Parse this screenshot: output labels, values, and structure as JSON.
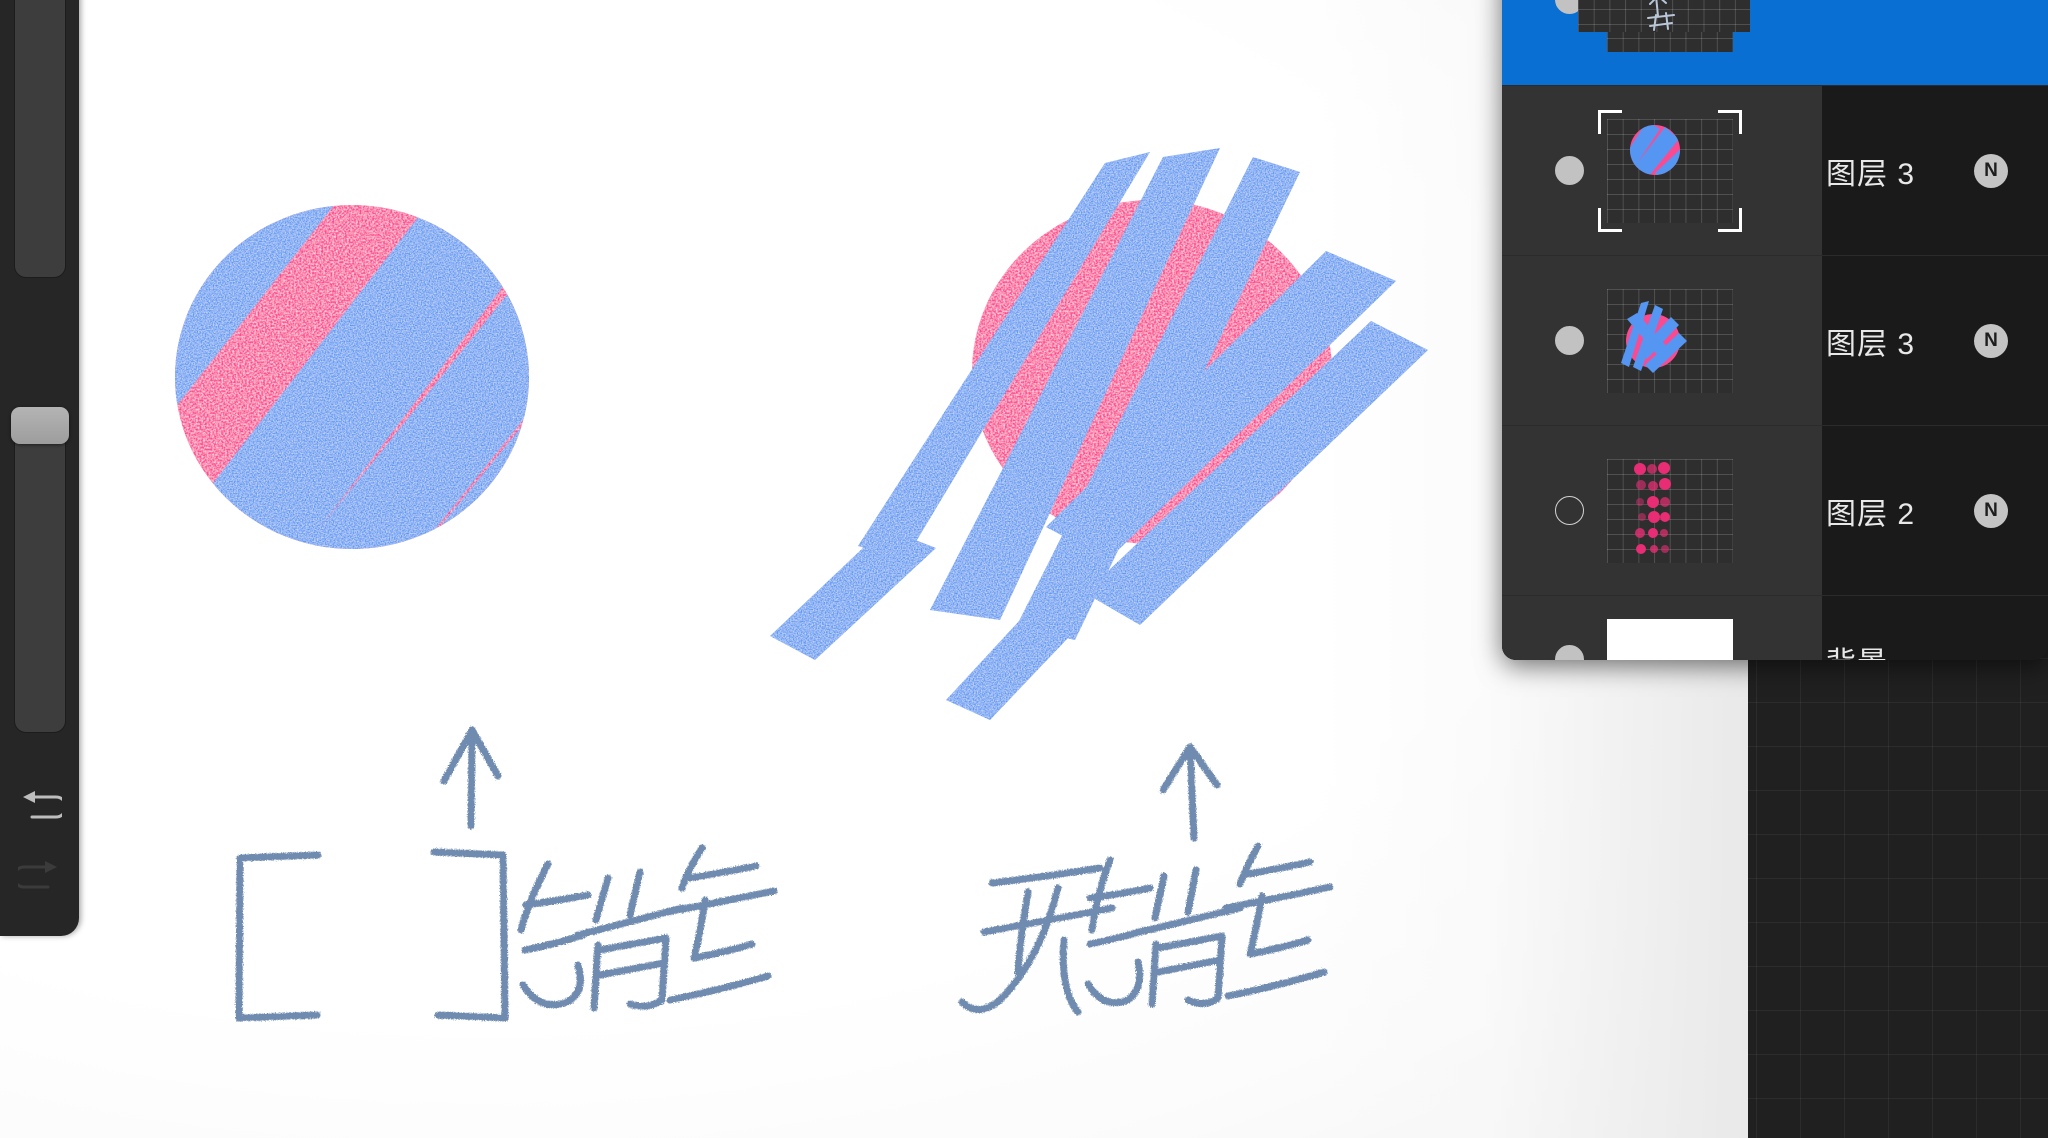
{
  "app": {
    "name": "drawing-app",
    "canvas_background": "#ffffff",
    "workspace_background": "#202020"
  },
  "colors": {
    "pink": "#fc4a91",
    "blue": "#5596f2",
    "pencil": "#6f8bb0",
    "panel_bg": "#1a1a1a",
    "row_left_bg": "#333333",
    "selected_row": "#0a6fd2",
    "rail_bg": "#262626"
  },
  "toolbar": {
    "brush_size_slider": {
      "name": "brush-size",
      "value_percent": 100
    },
    "opacity_slider": {
      "name": "opacity",
      "value_percent": 97
    },
    "undo_label": "undo",
    "undo_enabled": true,
    "redo_label": "redo",
    "redo_enabled": false
  },
  "layers_panel": {
    "title": "",
    "rows": [
      {
        "name": "",
        "selected": true,
        "visible": true,
        "blend_mode": "N",
        "thumb": "handwriting",
        "partial": true
      },
      {
        "name": "图层 3",
        "selected": false,
        "visible": true,
        "blend_mode": "N",
        "thumb": "striped-circle",
        "thumb_selected": true
      },
      {
        "name": "图层 3",
        "selected": false,
        "visible": true,
        "blend_mode": "N",
        "thumb": "scribbled-circle",
        "thumb_selected": false
      },
      {
        "name": "图层 2",
        "selected": false,
        "visible": false,
        "blend_mode": "N",
        "thumb": "pink-dots",
        "thumb_selected": false
      },
      {
        "name": "背景",
        "selected": false,
        "visible": true,
        "blend_mode": "",
        "thumb": "white",
        "thumb_selected": false
      }
    ]
  },
  "artwork": {
    "left_example": {
      "annotation_brackets": "[   ]",
      "annotation_text": "锁定",
      "arrow": "up-arrow",
      "description": "pink circle with blue stripes clipped inside circle"
    },
    "right_example": {
      "annotation_text": "无锁定",
      "arrow": "up-arrow",
      "description": "pink circle with blue strokes overflowing outside circle"
    }
  }
}
